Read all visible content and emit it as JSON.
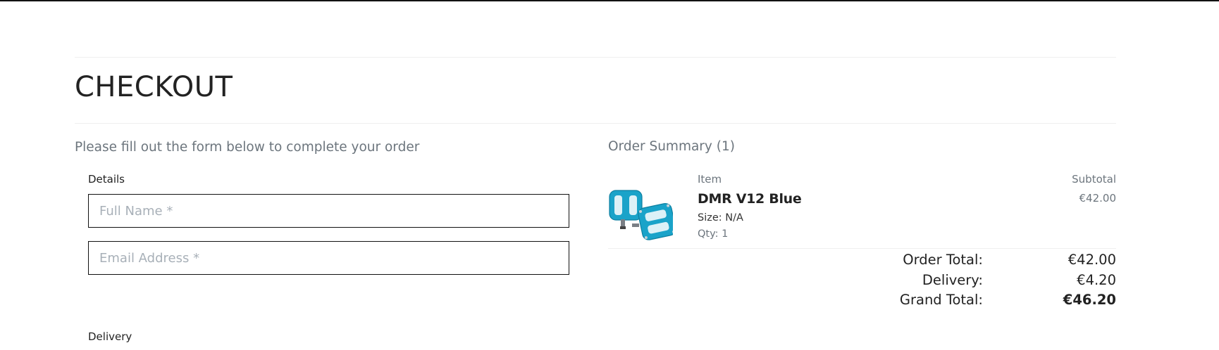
{
  "page": {
    "title": "CHECKOUT"
  },
  "form": {
    "intro": "Please fill out the form below to complete your order",
    "details_legend": "Details",
    "full_name_placeholder": "Full Name *",
    "email_placeholder": "Email Address *",
    "delivery_legend": "Delivery"
  },
  "summary": {
    "title": "Order Summary (1)",
    "col_item": "Item",
    "col_subtotal": "Subtotal",
    "items": [
      {
        "name": "DMR V12 Blue",
        "size": "Size: N/A",
        "qty": "Qty: 1",
        "subtotal": "€42.00",
        "image": "blue-pedals-image"
      }
    ],
    "order_total_label": "Order Total:",
    "order_total_value": "€42.00",
    "delivery_label": "Delivery:",
    "delivery_value": "€4.20",
    "grand_total_label": "Grand Total:",
    "grand_total_value": "€46.20"
  },
  "colors": {
    "muted_text": "#6c757d",
    "pedal_blue": "#1aa3c9",
    "border": "#111111"
  }
}
